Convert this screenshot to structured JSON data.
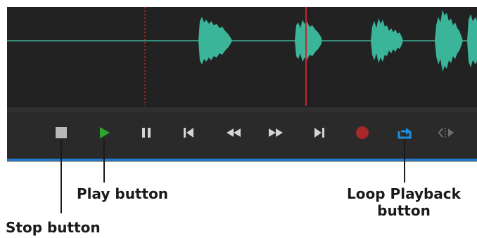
{
  "colors": {
    "waveform": "#3bb59a",
    "accent": "#1f7fd4",
    "playhead": "#c0282d",
    "play": "#2fa52f",
    "record": "#a8282a",
    "stop": "#b9b9b9",
    "panel": "#282828"
  },
  "transport": {
    "buttons": [
      {
        "id": "stop",
        "icon": "stop-icon"
      },
      {
        "id": "play",
        "icon": "play-icon"
      },
      {
        "id": "pause",
        "icon": "pause-icon"
      },
      {
        "id": "previous",
        "icon": "skip-back-icon"
      },
      {
        "id": "rewind",
        "icon": "rewind-icon"
      },
      {
        "id": "fast_forward",
        "icon": "fast-forward-icon"
      },
      {
        "id": "next",
        "icon": "skip-forward-icon"
      },
      {
        "id": "record",
        "icon": "record-icon"
      },
      {
        "id": "loop",
        "icon": "loop-icon",
        "active": true
      },
      {
        "id": "skip_selection",
        "icon": "skip-selection-icon",
        "disabled": true
      }
    ]
  },
  "callouts": {
    "play": "Play button",
    "stop": "Stop button",
    "loop_line1": "Loop Playback",
    "loop_line2": "button"
  }
}
